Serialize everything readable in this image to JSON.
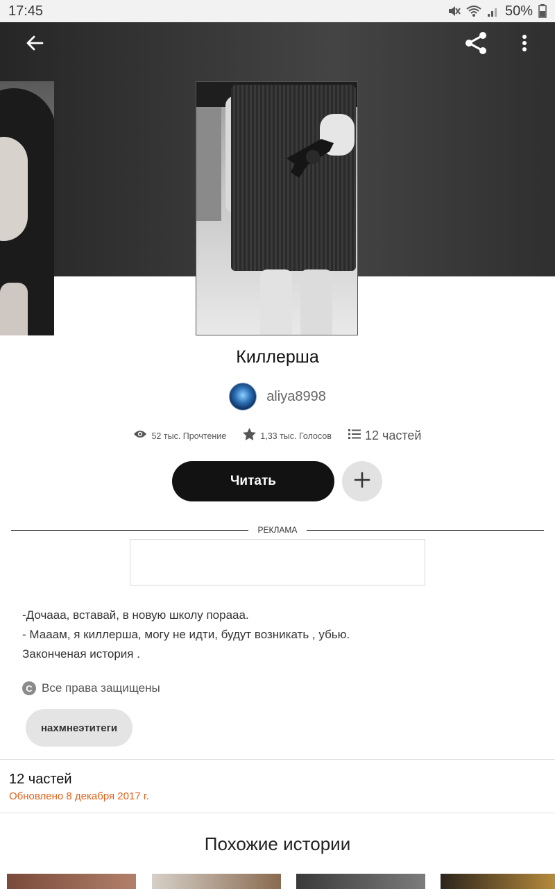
{
  "status_bar": {
    "time": "17:45",
    "battery_text": "50%"
  },
  "icons": {
    "back": "arrow-left-icon",
    "share": "share-icon",
    "more": "more-vertical-icon",
    "views": "eye-icon",
    "votes": "star-icon",
    "parts": "list-icon",
    "add": "plus-icon",
    "copyright": "copyright-icon"
  },
  "story": {
    "title": "Киллерша",
    "author": "aliya8998",
    "stats": {
      "reads": "52 тыс. Прочтение",
      "votes": "1,33 тыс. Голосов",
      "parts": "12 частей"
    },
    "read_button": "Читать",
    "description": [
      "-Дочааа, вставай, в новую школу пораaа.",
      "- Мааам, я киллерша, могу не идти, будут возникать , убью.",
      "Законченая история ."
    ],
    "copyright_symbol": "C",
    "rights": "Все права защищены",
    "tag": "нахмнеэтитеги"
  },
  "ad": {
    "label": "РЕКЛАМА"
  },
  "parts_section": {
    "count": "12 частей",
    "updated": "Обновлено 8 декабря 2017 г."
  },
  "similar": {
    "title": "Похожие истории"
  },
  "colors": {
    "accent_orange": "#e0621a",
    "button_dark": "#121212",
    "header_dark": "#333333"
  }
}
